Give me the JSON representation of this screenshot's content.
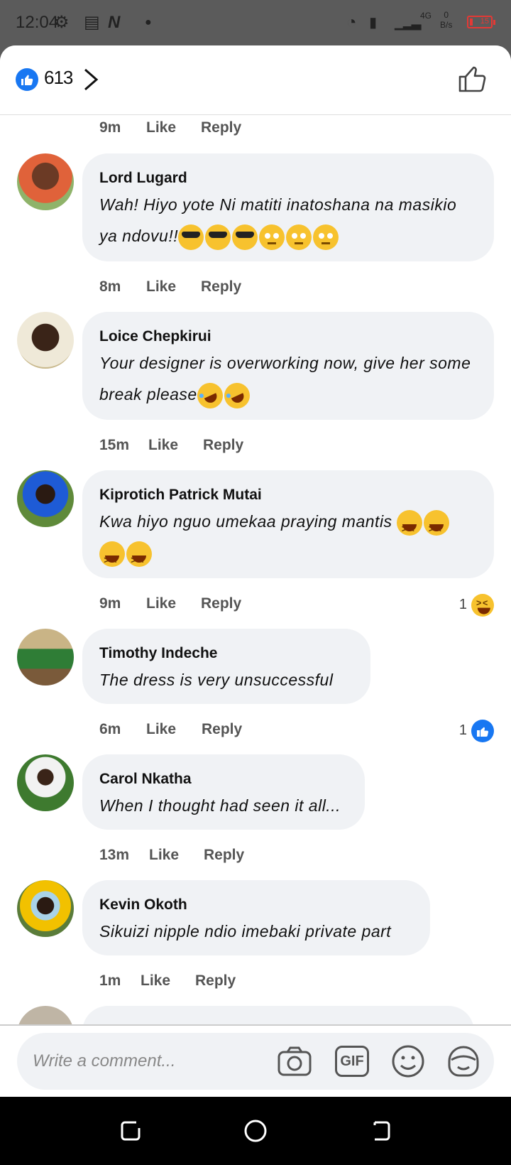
{
  "status_bar": {
    "time": "12:04",
    "net_speed": "0",
    "net_unit": "B/s",
    "network": "4G",
    "battery": "15",
    "battery_fraction": 0.15
  },
  "header": {
    "like_count": "613"
  },
  "top_meta": {
    "time": "9m",
    "like": "Like",
    "reply": "Reply"
  },
  "comments": [
    {
      "name": "Lord Lugard",
      "text": "Wah! Hiyo yote Ni matiti inatoshana na masikio ya ndovu!!",
      "emojis": [
        "sunglasses-emoji",
        "sunglasses-emoji",
        "sunglasses-emoji",
        "eye-roll-emoji",
        "eye-roll-emoji",
        "eye-roll-emoji"
      ],
      "time": "8m",
      "like": "Like",
      "reply": "Reply"
    },
    {
      "name": "Loice Chepkirui",
      "text": "Your designer is overworking now, give her some break please",
      "emojis": [
        "rofl-emoji",
        "rofl-emoji"
      ],
      "time": "15m",
      "like": "Like",
      "reply": "Reply"
    },
    {
      "name": "Kiprotich Patrick Mutai",
      "text": "Kwa hiyo nguo umekaa praying mantis",
      "emojis": [
        "laughing-emoji",
        "laughing-emoji",
        "laughing-emoji",
        "laughing-emoji"
      ],
      "time": "9m",
      "like": "Like",
      "reply": "Reply",
      "reaction_count": "1",
      "reaction": "haha"
    },
    {
      "name": "Timothy Indeche",
      "text": "The dress is very unsuccessful",
      "time": "6m",
      "like": "Like",
      "reply": "Reply",
      "reaction_count": "1",
      "reaction": "like"
    },
    {
      "name": "Carol Nkatha",
      "text": "When I thought had seen it all...",
      "time": "13m",
      "like": "Like",
      "reply": "Reply"
    },
    {
      "name": "Kevin Okoth",
      "text": "Sikuizi nipple ndio imebaki private part",
      "time": "1m",
      "like": "Like",
      "reply": "Reply"
    }
  ],
  "composer": {
    "placeholder": "Write a comment...",
    "gif_label": "GIF"
  },
  "colors": {
    "brand_blue": "#1877f2",
    "bubble": "#f0f2f5",
    "battery_low": "#e53935"
  }
}
